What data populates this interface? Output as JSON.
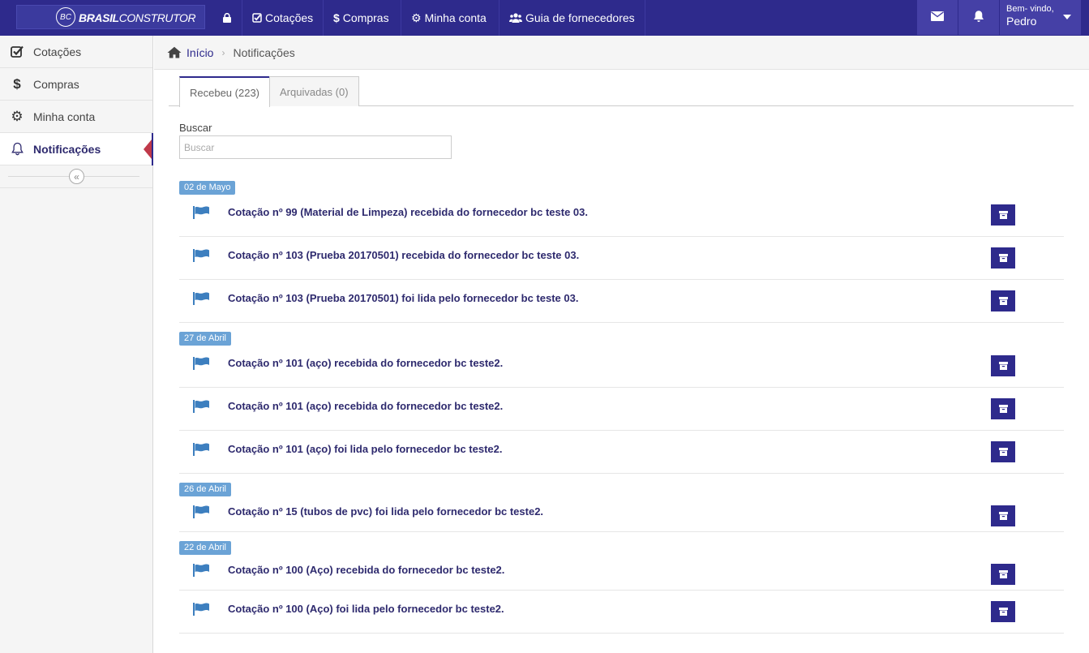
{
  "header": {
    "logo_badge": "BC",
    "logo_text_bold": "BRASIL",
    "logo_text_rest": "CONSTRUTOR",
    "nav": [
      {
        "label": "Cotações",
        "icon": "check-square-icon"
      },
      {
        "label": "Compras",
        "icon": "dollar-icon"
      },
      {
        "label": "Minha conta",
        "icon": "gear-icon"
      },
      {
        "label": "Guia de fornecedores",
        "icon": "users-icon"
      }
    ],
    "greeting": "Bem- vindo,",
    "user_name": "Pedro"
  },
  "sidebar": {
    "items": [
      {
        "label": "Cotações",
        "icon": "check-square-icon"
      },
      {
        "label": "Compras",
        "icon": "dollar-icon"
      },
      {
        "label": "Minha conta",
        "icon": "gear-icon"
      },
      {
        "label": "Notificações",
        "icon": "bell-icon",
        "active": true
      }
    ],
    "collapse_glyph": "«"
  },
  "breadcrumb": {
    "home": "Início",
    "separator": "›",
    "current": "Notificações"
  },
  "tabs": [
    {
      "label": "Recebeu (223)",
      "active": true
    },
    {
      "label": "Arquivadas (0)",
      "active": false
    }
  ],
  "search": {
    "label": "Buscar",
    "placeholder": "Buscar"
  },
  "groups": [
    {
      "date": "02 de Mayo",
      "items": [
        "Cotação nº 99 (Material de Limpeza) recebida do fornecedor bc teste 03.",
        "Cotação nº 103 (Prueba 20170501) recebida do fornecedor bc teste 03.",
        "Cotação nº 103 (Prueba 20170501) foi lida pelo fornecedor bc teste 03."
      ]
    },
    {
      "date": "27 de Abril",
      "items": [
        "Cotação nº 101 (aço) recebida do fornecedor bc teste2.",
        "Cotação nº 101 (aço) recebida do fornecedor bc teste2.",
        "Cotação nº 101 (aço) foi lida pelo fornecedor bc teste2."
      ]
    },
    {
      "date": "26 de Abril",
      "items": [
        "Cotação nº 15 (tubos de pvc) foi lida pelo fornecedor bc teste2."
      ]
    },
    {
      "date": "22 de Abril",
      "items": [
        "Cotação nº 100 (Aço) recebida do fornecedor bc teste2.",
        "Cotação nº 100 (Aço) foi lida pelo fornecedor bc teste2."
      ]
    }
  ],
  "colors": {
    "brand": "#2e2a8c",
    "accent_arrow": "#c0394a",
    "date_badge": "#6ba3d6",
    "flag": "#3d7fbf"
  }
}
